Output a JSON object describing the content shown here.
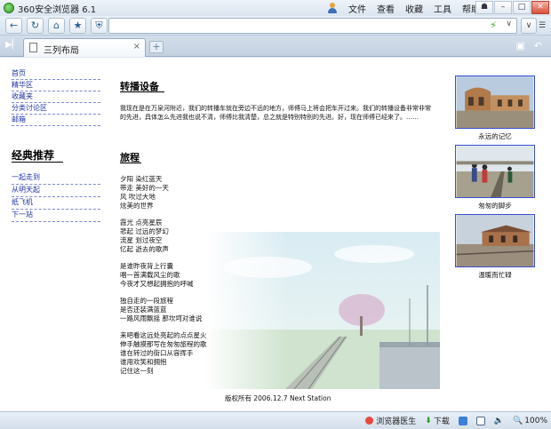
{
  "window": {
    "title": "360安全浏览器 6.1",
    "menu": [
      "文件",
      "查看",
      "收藏",
      "工具",
      "帮助"
    ],
    "win_buttons": [
      "☗",
      "–",
      "□",
      "✕"
    ]
  },
  "nav": {
    "back": "←",
    "refresh": "↻",
    "home": "⌂",
    "favorite": "★",
    "shield": "⛨",
    "address_value": "",
    "bolt": "⚡",
    "dropdown": "∨",
    "go_dropdown": "∨"
  },
  "tabs": {
    "active_label": "三列布局",
    "close": "×",
    "new": "+"
  },
  "page": {
    "left_links": [
      "首页",
      "精华区",
      "收藏夹",
      "分类讨论区",
      "邮箱"
    ],
    "section_title": "经典推荐",
    "recommend_links": [
      "一起走到",
      "从明天起",
      "纸飞机",
      "下一站"
    ],
    "heading_equipment": "转播设备",
    "paragraph": "我现在是在万泉河附近，我们的转播车就在旁边不远的地方，师傅马上将会把车开过来。我们的转播设备非常非常的先进，具体怎么先进我也说不清，师傅比我清楚，总之就是特别特别的先进。好，现在师傅已经来了。……",
    "heading_travel": "旅程",
    "poem": [
      [
        "夕阳 染红蓝天",
        "带走 美好的一天",
        "风 吹过大地",
        "炫美的世界"
      ],
      [
        "霞光 点亮星辰",
        "悲起 过远的梦幻",
        "流星 划过夜空",
        "忆起 逝去的歌声"
      ],
      [
        "是谁昨夜背上行囊",
        "唱一首满载风尘的歌",
        "今夜才又想起拥抱的呼喊"
      ],
      [
        "独自走的一段旅程",
        "是否还装满蓝蓝",
        "一路风雨飘摇 那坎坷对谁说"
      ],
      [
        "来吧看这远处亮起的点点星火",
        "伸手触摸那写在匆匆旅程的歌",
        "谁在转过的街口从容挥手",
        "谁用欢笑和拥抱",
        "记住这一刻"
      ]
    ],
    "copyright": "版权所有 2006.12.7 Next Station",
    "thumbnails": [
      {
        "caption": "永远的记忆"
      },
      {
        "caption": "匆匆的脚步"
      },
      {
        "caption": "温暖而忙碌"
      }
    ]
  },
  "status": {
    "doctor": "浏览器医生",
    "download": "下载",
    "zoom": "100%"
  }
}
